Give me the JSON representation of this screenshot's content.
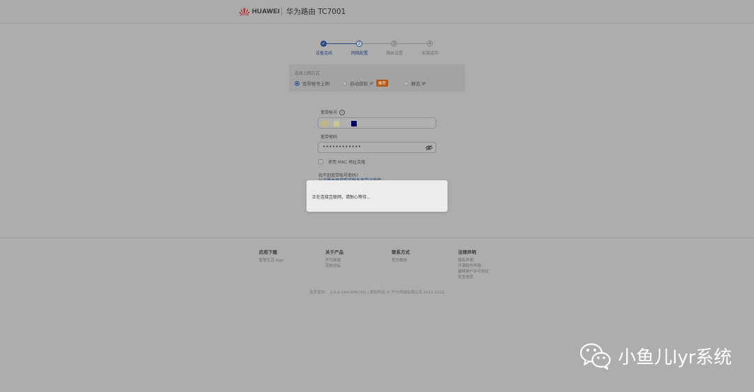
{
  "header": {
    "brand": "HUAWEI",
    "product_title": "华为路由 TC7001"
  },
  "stepper": {
    "steps": [
      {
        "number": "✓",
        "label": "设备连线",
        "state": "done"
      },
      {
        "number": "2",
        "label": "网络配置",
        "state": "active"
      },
      {
        "number": "3",
        "label": "路由设置",
        "state": "pending"
      },
      {
        "number": "4",
        "label": "安装成功",
        "state": "pending"
      }
    ]
  },
  "connection": {
    "title": "选择上网方式",
    "options": [
      {
        "label": "宽带帐号上网",
        "checked": true
      },
      {
        "label": "自动获取 IP",
        "checked": false,
        "badge": "推荐"
      },
      {
        "label": "静态 IP",
        "checked": false
      }
    ]
  },
  "form": {
    "account_label": "宽带帐号",
    "info_icon": "i",
    "account_swatches": [
      "#c8b27c",
      "#c8c890",
      "#000066"
    ],
    "password_label": "宽带密码",
    "password_value": "••••••••••••",
    "mac_clone_label": "使用 MAC 地址克隆",
    "forgot_question": "找不到宽带帐号密码?",
    "forgot_link": "从旧路由器获取或联系宽带运营商"
  },
  "modal": {
    "message": "正在连接互联网，请耐心等待..."
  },
  "footer": {
    "columns": [
      {
        "heading": "应用下载",
        "links": [
          "智慧生活 App"
        ]
      },
      {
        "heading": "关于产品",
        "links": [
          "华为商城",
          "花粉论坛"
        ]
      },
      {
        "heading": "联系方式",
        "links": [
          "官方微信"
        ]
      },
      {
        "heading": "法律声明",
        "links": [
          "隐私声明",
          "开源软件声明",
          "最终用户许可协议",
          "安全信息"
        ]
      }
    ],
    "copyright": "软件版本： 2.0.0.194(SP8C30)  |  版权所有 © 华为终端有限公司 2012-2022"
  },
  "watermark": {
    "text": "小鱼儿lyr系统"
  },
  "colors": {
    "accent": "#2c4a80",
    "badge": "#b55a14",
    "overlay_bg": "#adadad"
  }
}
